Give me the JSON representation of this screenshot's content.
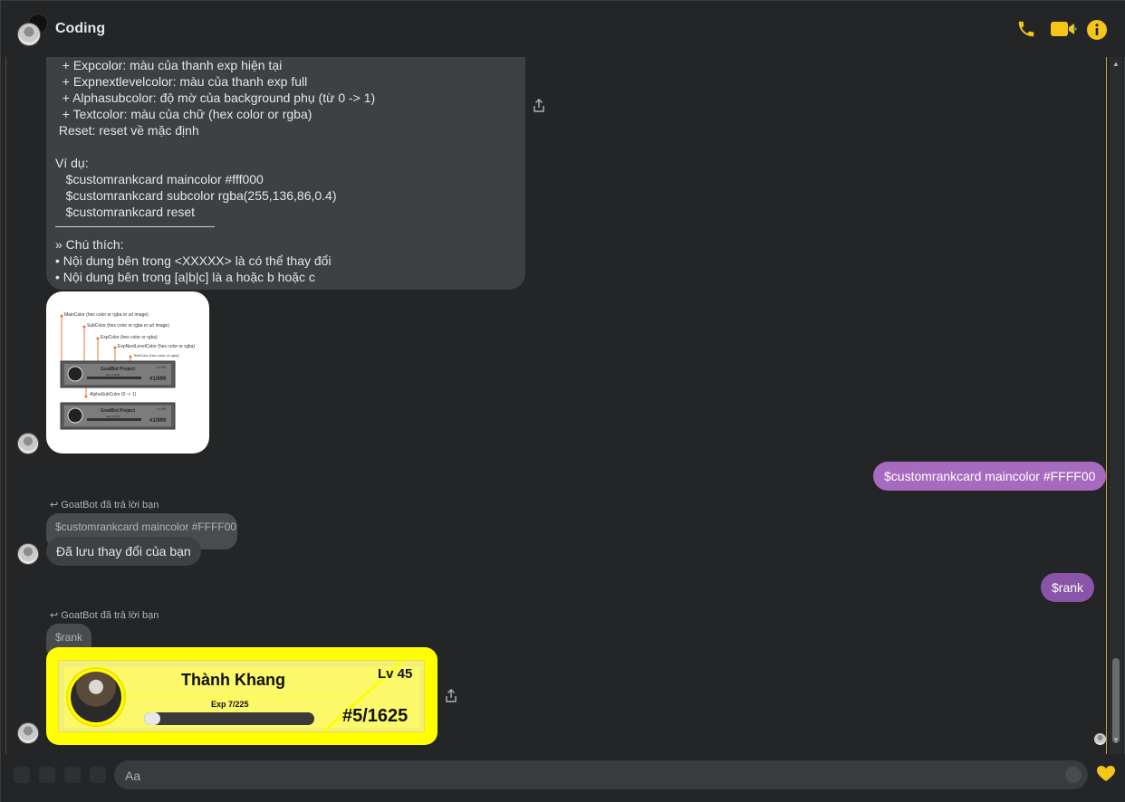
{
  "header": {
    "title": "Coding",
    "icons": [
      "phone-icon",
      "video-icon",
      "info-icon"
    ],
    "accent": "#f5c518"
  },
  "help_text": {
    "lines": [
      "  + Expcolor: màu của thanh exp hiện tại",
      "  + Expnextlevelcolor: màu của thanh exp full",
      "  + Alphasubcolor: độ mờ của background phụ (từ 0 -> 1)",
      "  + Textcolor: màu của chữ (hex color or rgba)",
      " Reset: reset về mặc định",
      "",
      "Ví dụ:",
      "   $customrankcard maincolor #fff000",
      "   $customrankcard subcolor rgba(255,136,86,0.4)",
      "   $customrankcard reset",
      "",
      "» Chú thích:",
      "• Nội dung bên trong <XXXXX> là có thể thay đổi",
      "• Nội dung bên trong [a|b|c] là a hoặc b hoặc c"
    ]
  },
  "diagram": {
    "labels": [
      "MainColor (hex color or rgba or url image)",
      "SubColor (hex color or rgba or url image)",
      "ExpColor (hex color or rgba)",
      "ExpNextLevelColor (hex color or rgba)",
      "TextColor (hex color or rgba)",
      "AlphaSubColor (0 -> 1)"
    ],
    "card_title": "GoatBot Project",
    "card_level": "Lv 99",
    "card_exp": "Exp 1/1000",
    "card_rank": "#1/999"
  },
  "messages": {
    "sent1": "$customrankcard maincolor #FFFF00",
    "reply_note1": "GoatBot đã trả lời bạn",
    "quote1": "$customrankcard maincolor #FFFF00",
    "reply1": "Đã lưu thay đổi của bạn",
    "sent2": "$rank",
    "reply_note2": "GoatBot đã trả lời bạn",
    "quote2": "$rank"
  },
  "rank_card": {
    "name": "Thành Khang",
    "level": "Lv 45",
    "exp_label": "Exp 7/225",
    "exp_progress": 0.031,
    "rank": "#5/1625",
    "main_color": "#ffff00"
  },
  "composer": {
    "placeholder": "Aa",
    "emoji_icon": "smiley-icon",
    "like_icon": "yellow-heart-icon"
  },
  "colors": {
    "sent_bubble_1": "#a66bbe",
    "sent_bubble_2": "#8a55a8",
    "received_bubble": "#3e4042"
  }
}
